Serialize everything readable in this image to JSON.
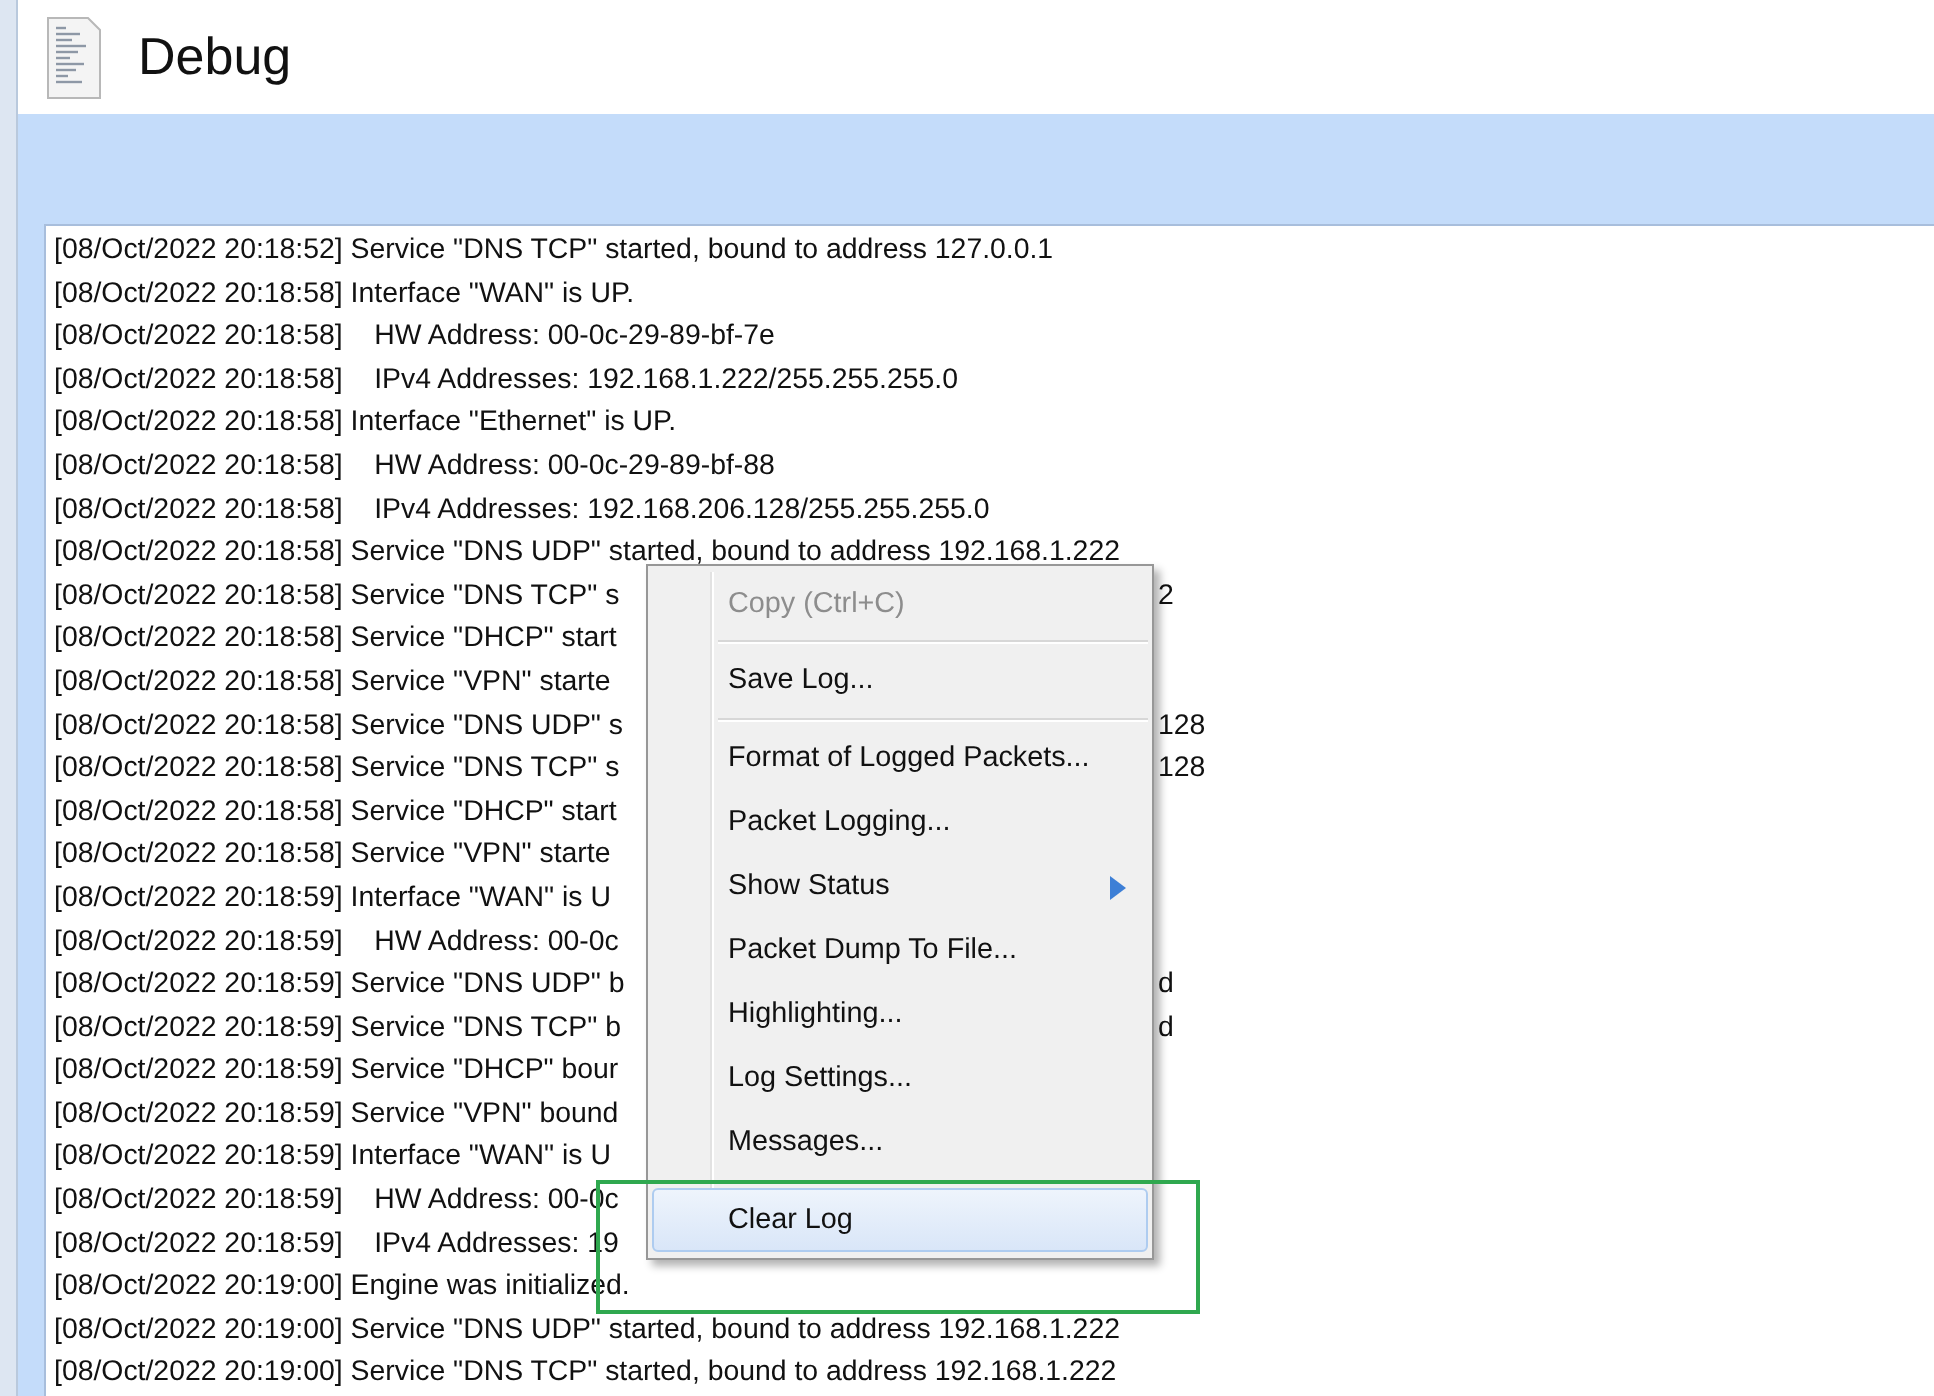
{
  "window": {
    "title": "Debug"
  },
  "log": {
    "lines": [
      {
        "text": "[08/Oct/2022 20:18:52] Service \"DNS TCP\" started, bound to address 127.0.0.1"
      },
      {
        "text": "[08/Oct/2022 20:18:58] Interface \"WAN\" is UP."
      },
      {
        "text": "[08/Oct/2022 20:18:58]    HW Address: 00-0c-29-89-bf-7e"
      },
      {
        "text": "[08/Oct/2022 20:18:58]    IPv4 Addresses: 192.168.1.222/255.255.255.0"
      },
      {
        "text": "[08/Oct/2022 20:18:58] Interface \"Ethernet\" is UP."
      },
      {
        "text": "[08/Oct/2022 20:18:58]    HW Address: 00-0c-29-89-bf-88"
      },
      {
        "text": "[08/Oct/2022 20:18:58]    IPv4 Addresses: 192.168.206.128/255.255.255.0"
      },
      {
        "text": "[08/Oct/2022 20:18:58] Service \"DNS UDP\" started, bound to address 192.168.1.222"
      },
      {
        "text": "[08/Oct/2022 20:18:58] Service \"DNS TCP\" s",
        "tail": "2"
      },
      {
        "text": "[08/Oct/2022 20:18:58] Service \"DHCP\" start"
      },
      {
        "text": "[08/Oct/2022 20:18:58] Service \"VPN\" starte"
      },
      {
        "text": "[08/Oct/2022 20:18:58] Service \"DNS UDP\" s",
        "tail": "128"
      },
      {
        "text": "[08/Oct/2022 20:18:58] Service \"DNS TCP\" s",
        "tail": "128"
      },
      {
        "text": "[08/Oct/2022 20:18:58] Service \"DHCP\" start"
      },
      {
        "text": "[08/Oct/2022 20:18:58] Service \"VPN\" starte"
      },
      {
        "text": "[08/Oct/2022 20:18:59] Interface \"WAN\" is U"
      },
      {
        "text": "[08/Oct/2022 20:18:59]    HW Address: 00-0c"
      },
      {
        "text": "[08/Oct/2022 20:18:59] Service \"DNS UDP\" b",
        "tail": "d"
      },
      {
        "text": "[08/Oct/2022 20:18:59] Service \"DNS TCP\" b",
        "tail": "d"
      },
      {
        "text": "[08/Oct/2022 20:18:59] Service \"DHCP\" bour"
      },
      {
        "text": "[08/Oct/2022 20:18:59] Service \"VPN\" bound"
      },
      {
        "text": "[08/Oct/2022 20:18:59] Interface \"WAN\" is U"
      },
      {
        "text": "[08/Oct/2022 20:18:59]    HW Address: 00-0c"
      },
      {
        "text": "[08/Oct/2022 20:18:59]    IPv4 Addresses: 19"
      },
      {
        "text": "[08/Oct/2022 20:19:00] Engine was initialized."
      },
      {
        "text": "[08/Oct/2022 20:19:00] Service \"DNS UDP\" started, bound to address 192.168.1.222"
      },
      {
        "text": "[08/Oct/2022 20:19:00] Service \"DNS TCP\" started, bound to address 192.168.1.222"
      }
    ]
  },
  "context_menu": {
    "items": [
      {
        "kind": "item",
        "label": "Copy (Ctrl+C)",
        "disabled": true,
        "selected": false
      },
      {
        "kind": "separator"
      },
      {
        "kind": "item",
        "label": "Save Log...",
        "disabled": false,
        "selected": false
      },
      {
        "kind": "separator"
      },
      {
        "kind": "item",
        "label": "Format of Logged Packets...",
        "disabled": false,
        "selected": false
      },
      {
        "kind": "item",
        "label": "Packet Logging...",
        "disabled": false,
        "selected": false
      },
      {
        "kind": "submenu",
        "label": "Show Status",
        "disabled": false,
        "selected": false
      },
      {
        "kind": "item",
        "label": "Packet Dump To File...",
        "disabled": false,
        "selected": false
      },
      {
        "kind": "item",
        "label": "Highlighting...",
        "disabled": false,
        "selected": false
      },
      {
        "kind": "item",
        "label": "Log Settings...",
        "disabled": false,
        "selected": false
      },
      {
        "kind": "item",
        "label": "Messages...",
        "disabled": false,
        "selected": false
      },
      {
        "kind": "separator"
      },
      {
        "kind": "item",
        "label": "Clear Log",
        "disabled": false,
        "selected": true
      }
    ]
  }
}
